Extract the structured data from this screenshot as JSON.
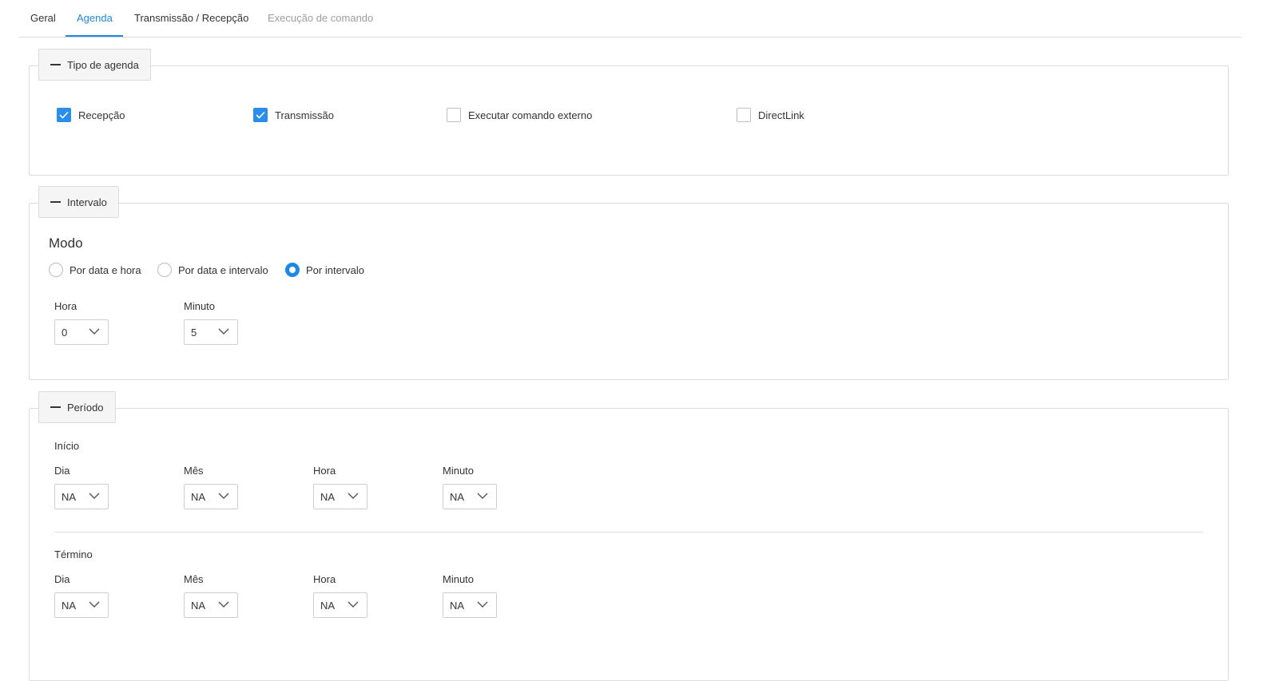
{
  "tabs": [
    {
      "label": "Geral",
      "state": "normal"
    },
    {
      "label": "Agenda",
      "state": "active"
    },
    {
      "label": "Transmissão / Recepção",
      "state": "normal"
    },
    {
      "label": "Execução de comando",
      "state": "disabled"
    }
  ],
  "colors": {
    "accent": "#1e88e5",
    "checkbox": "#2b8cf0",
    "border": "#dcdcdc",
    "legend_bg": "#f5f5f5"
  },
  "tipo_agenda": {
    "legend": "Tipo de agenda",
    "options": [
      {
        "label": "Recepção",
        "checked": true
      },
      {
        "label": "Transmissão",
        "checked": true
      },
      {
        "label": "Executar comando externo",
        "checked": false
      },
      {
        "label": "DirectLink",
        "checked": false
      }
    ]
  },
  "intervalo": {
    "legend": "Intervalo",
    "mode_title": "Modo",
    "modes": [
      {
        "label": "Por data e hora",
        "selected": false
      },
      {
        "label": "Por data e intervalo",
        "selected": false
      },
      {
        "label": "Por intervalo",
        "selected": true
      }
    ],
    "hora": {
      "label": "Hora",
      "value": "0"
    },
    "minuto": {
      "label": "Minuto",
      "value": "5"
    }
  },
  "periodo": {
    "legend": "Período",
    "inicio": {
      "title": "Início",
      "dia": {
        "label": "Dia",
        "value": "NA"
      },
      "mes": {
        "label": "Mês",
        "value": "NA"
      },
      "hora": {
        "label": "Hora",
        "value": "NA"
      },
      "minuto": {
        "label": "Minuto",
        "value": "NA"
      }
    },
    "termino": {
      "title": "Término",
      "dia": {
        "label": "Dia",
        "value": "NA"
      },
      "mes": {
        "label": "Mês",
        "value": "NA"
      },
      "hora": {
        "label": "Hora",
        "value": "NA"
      },
      "minuto": {
        "label": "Minuto",
        "value": "NA"
      }
    }
  }
}
